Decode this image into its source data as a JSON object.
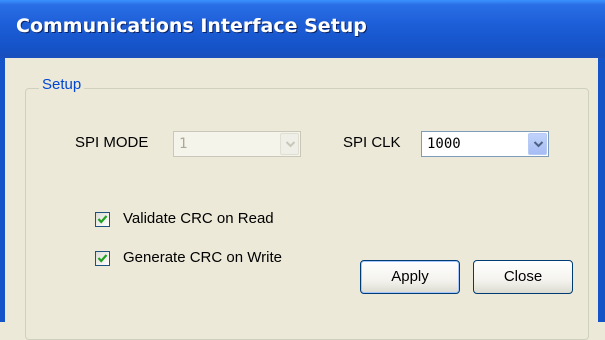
{
  "window": {
    "title": "Communications Interface Setup"
  },
  "setup_group": {
    "legend": "Setup",
    "spi_mode": {
      "label": "SPI MODE",
      "value": "1",
      "enabled": false
    },
    "spi_clk": {
      "label": "SPI CLK",
      "value": "1000",
      "enabled": true
    },
    "validate_crc": {
      "label": "Validate CRC on Read",
      "checked": true
    },
    "generate_crc": {
      "label": "Generate CRC on Write",
      "checked": true
    },
    "apply_label": "Apply",
    "close_label": "Close"
  },
  "colors": {
    "titlebar": "#1D5FD8",
    "window_bg": "#ECE9D8",
    "legend_text": "#0046D5",
    "checkmark": "#21A121"
  },
  "icons": {
    "dropdown": "chevron-down-icon",
    "check": "checkmark-icon"
  }
}
